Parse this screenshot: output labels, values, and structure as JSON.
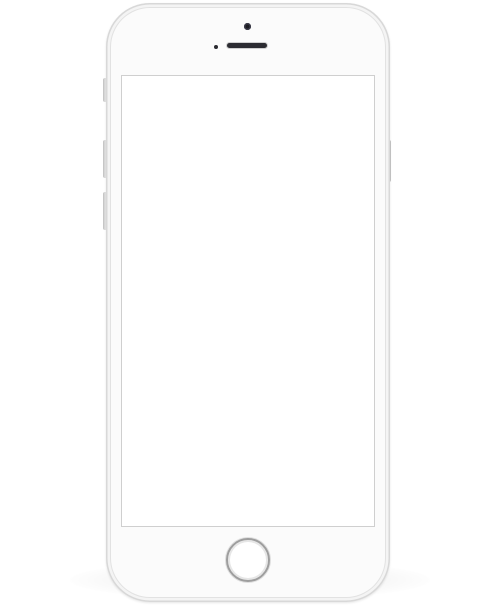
{
  "device": {
    "type": "smartphone",
    "finish": "white-silver",
    "body_color": "#fbfbfb",
    "screen_color": "#ffffff",
    "screen_content": "",
    "icons": {
      "home_button": "home-button-icon",
      "camera": "camera-icon",
      "speaker": "speaker-grille-icon"
    }
  }
}
